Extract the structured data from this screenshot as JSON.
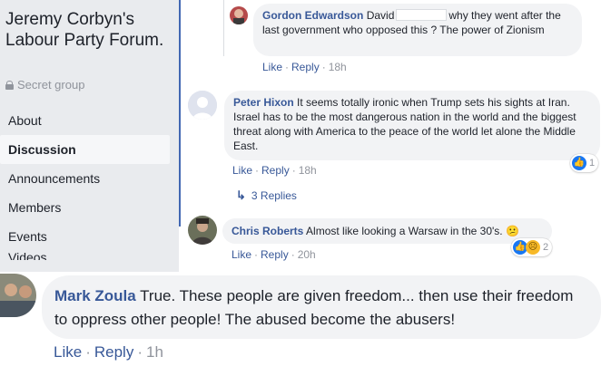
{
  "sidebar": {
    "group_name": "Jeremy Corbyn's Labour Party Forum.",
    "privacy": "Secret group",
    "nav": [
      "About",
      "Discussion",
      "Announcements",
      "Members",
      "Events",
      "Videos"
    ]
  },
  "comments": [
    {
      "author": "Gordon Edwardson",
      "text_before": "David",
      "text_after": "why they went after the last government who opposed this ? The power of Zionism",
      "like": "Like",
      "reply": "Reply",
      "time": "18h"
    },
    {
      "author": "Peter Hixon",
      "text": "It seems totally ironic when Trump sets his sights at Iran. Israel has to be the most dangerous nation in the world and the biggest threat along with America to the peace of the world let alone the Middle East.",
      "like": "Like",
      "reply": "Reply",
      "time": "18h",
      "reaction_count": "1",
      "replies_label": "3 Replies"
    },
    {
      "author": "Chris Roberts",
      "text": "Almost like looking a Warsaw in the 30's.",
      "emoji": "😕",
      "like": "Like",
      "reply": "Reply",
      "time": "20h",
      "reaction_count": "2"
    },
    {
      "author": "Mark Zoula",
      "text": "True. These people are given freedom... then use their freedom to oppress other people! The abused become the abusers!",
      "like": "Like",
      "reply": "Reply",
      "time": "1h"
    }
  ],
  "colors": {
    "link": "#385898",
    "bubble": "#f2f3f5",
    "sidebar_bg": "#e9ebee",
    "meta": "#90949c"
  }
}
